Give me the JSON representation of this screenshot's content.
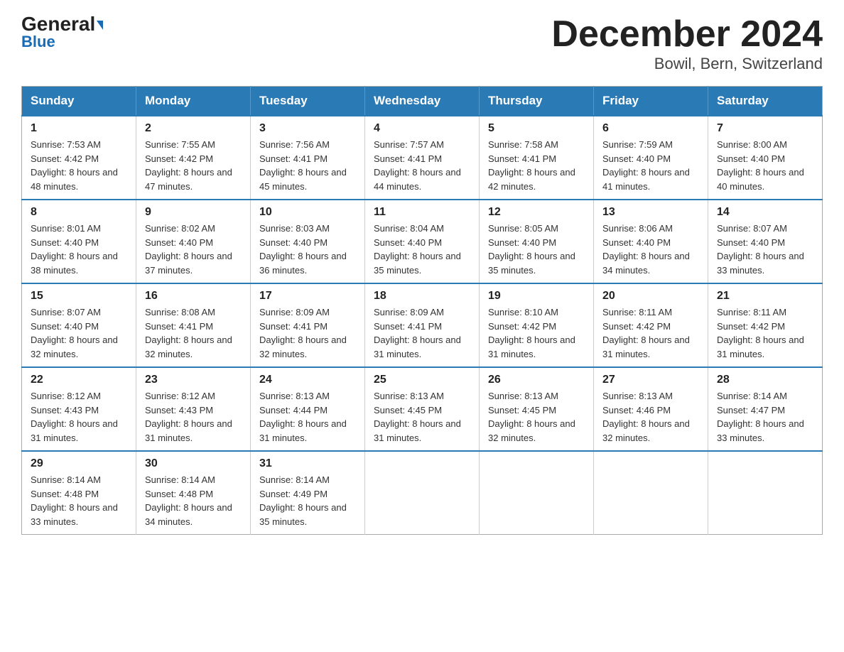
{
  "logo": {
    "general": "General",
    "blue": "Blue",
    "arrow": "▶"
  },
  "title": "December 2024",
  "subtitle": "Bowil, Bern, Switzerland",
  "weekdays": [
    "Sunday",
    "Monday",
    "Tuesday",
    "Wednesday",
    "Thursday",
    "Friday",
    "Saturday"
  ],
  "weeks": [
    [
      {
        "day": "1",
        "sunrise": "7:53 AM",
        "sunset": "4:42 PM",
        "daylight": "8 hours and 48 minutes."
      },
      {
        "day": "2",
        "sunrise": "7:55 AM",
        "sunset": "4:42 PM",
        "daylight": "8 hours and 47 minutes."
      },
      {
        "day": "3",
        "sunrise": "7:56 AM",
        "sunset": "4:41 PM",
        "daylight": "8 hours and 45 minutes."
      },
      {
        "day": "4",
        "sunrise": "7:57 AM",
        "sunset": "4:41 PM",
        "daylight": "8 hours and 44 minutes."
      },
      {
        "day": "5",
        "sunrise": "7:58 AM",
        "sunset": "4:41 PM",
        "daylight": "8 hours and 42 minutes."
      },
      {
        "day": "6",
        "sunrise": "7:59 AM",
        "sunset": "4:40 PM",
        "daylight": "8 hours and 41 minutes."
      },
      {
        "day": "7",
        "sunrise": "8:00 AM",
        "sunset": "4:40 PM",
        "daylight": "8 hours and 40 minutes."
      }
    ],
    [
      {
        "day": "8",
        "sunrise": "8:01 AM",
        "sunset": "4:40 PM",
        "daylight": "8 hours and 38 minutes."
      },
      {
        "day": "9",
        "sunrise": "8:02 AM",
        "sunset": "4:40 PM",
        "daylight": "8 hours and 37 minutes."
      },
      {
        "day": "10",
        "sunrise": "8:03 AM",
        "sunset": "4:40 PM",
        "daylight": "8 hours and 36 minutes."
      },
      {
        "day": "11",
        "sunrise": "8:04 AM",
        "sunset": "4:40 PM",
        "daylight": "8 hours and 35 minutes."
      },
      {
        "day": "12",
        "sunrise": "8:05 AM",
        "sunset": "4:40 PM",
        "daylight": "8 hours and 35 minutes."
      },
      {
        "day": "13",
        "sunrise": "8:06 AM",
        "sunset": "4:40 PM",
        "daylight": "8 hours and 34 minutes."
      },
      {
        "day": "14",
        "sunrise": "8:07 AM",
        "sunset": "4:40 PM",
        "daylight": "8 hours and 33 minutes."
      }
    ],
    [
      {
        "day": "15",
        "sunrise": "8:07 AM",
        "sunset": "4:40 PM",
        "daylight": "8 hours and 32 minutes."
      },
      {
        "day": "16",
        "sunrise": "8:08 AM",
        "sunset": "4:41 PM",
        "daylight": "8 hours and 32 minutes."
      },
      {
        "day": "17",
        "sunrise": "8:09 AM",
        "sunset": "4:41 PM",
        "daylight": "8 hours and 32 minutes."
      },
      {
        "day": "18",
        "sunrise": "8:09 AM",
        "sunset": "4:41 PM",
        "daylight": "8 hours and 31 minutes."
      },
      {
        "day": "19",
        "sunrise": "8:10 AM",
        "sunset": "4:42 PM",
        "daylight": "8 hours and 31 minutes."
      },
      {
        "day": "20",
        "sunrise": "8:11 AM",
        "sunset": "4:42 PM",
        "daylight": "8 hours and 31 minutes."
      },
      {
        "day": "21",
        "sunrise": "8:11 AM",
        "sunset": "4:42 PM",
        "daylight": "8 hours and 31 minutes."
      }
    ],
    [
      {
        "day": "22",
        "sunrise": "8:12 AM",
        "sunset": "4:43 PM",
        "daylight": "8 hours and 31 minutes."
      },
      {
        "day": "23",
        "sunrise": "8:12 AM",
        "sunset": "4:43 PM",
        "daylight": "8 hours and 31 minutes."
      },
      {
        "day": "24",
        "sunrise": "8:13 AM",
        "sunset": "4:44 PM",
        "daylight": "8 hours and 31 minutes."
      },
      {
        "day": "25",
        "sunrise": "8:13 AM",
        "sunset": "4:45 PM",
        "daylight": "8 hours and 31 minutes."
      },
      {
        "day": "26",
        "sunrise": "8:13 AM",
        "sunset": "4:45 PM",
        "daylight": "8 hours and 32 minutes."
      },
      {
        "day": "27",
        "sunrise": "8:13 AM",
        "sunset": "4:46 PM",
        "daylight": "8 hours and 32 minutes."
      },
      {
        "day": "28",
        "sunrise": "8:14 AM",
        "sunset": "4:47 PM",
        "daylight": "8 hours and 33 minutes."
      }
    ],
    [
      {
        "day": "29",
        "sunrise": "8:14 AM",
        "sunset": "4:48 PM",
        "daylight": "8 hours and 33 minutes."
      },
      {
        "day": "30",
        "sunrise": "8:14 AM",
        "sunset": "4:48 PM",
        "daylight": "8 hours and 34 minutes."
      },
      {
        "day": "31",
        "sunrise": "8:14 AM",
        "sunset": "4:49 PM",
        "daylight": "8 hours and 35 minutes."
      },
      null,
      null,
      null,
      null
    ]
  ]
}
